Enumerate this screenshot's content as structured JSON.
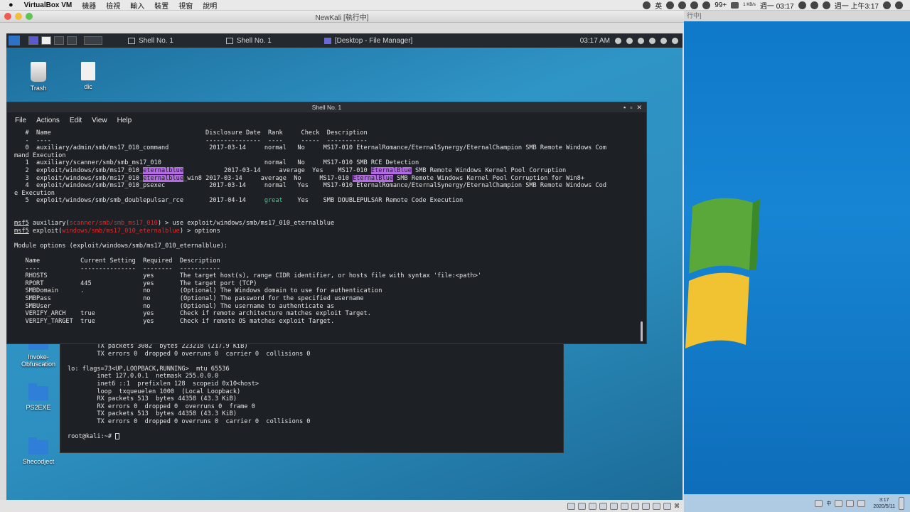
{
  "macbar": {
    "app": "VirtualBox VM",
    "menus": [
      "機器",
      "檢視",
      "輸入",
      "裝置",
      "視窗",
      "說明"
    ],
    "lang": "英",
    "battery_pct": "99+",
    "net_speed_up": "1 KB/s",
    "net_speed_down": "1 KB/s",
    "clock_small": "週一 03:17",
    "clock": "週一 上午3:17"
  },
  "vbox": {
    "title": "NewKali [執行中]",
    "right_title": "行中]"
  },
  "kali_panel": {
    "tasks": [
      {
        "label": "Shell No. 1"
      },
      {
        "label": "Shell No. 1"
      },
      {
        "label": "[Desktop - File Manager]"
      }
    ],
    "time": "03:17 AM"
  },
  "desktop_icons": [
    {
      "label": "Trash"
    },
    {
      "label": "dic"
    },
    {
      "label": "Invoke-Obfuscation"
    },
    {
      "label": "PS2EXE"
    },
    {
      "label": "Shecodject"
    }
  ],
  "fg_terminal": {
    "title": "Shell No. 1",
    "menu": [
      "File",
      "Actions",
      "Edit",
      "View",
      "Help"
    ],
    "search_header": "   #  Name                                          Disclosure Date  Rank     Check  Description",
    "search_rule": "   -  ----                                          ---------------  ----     -----  -----------",
    "search_rows": [
      {
        "pre": "   0  auxiliary/admin/smb/ms17_010_command           ",
        "hl": "",
        "mid": "",
        "date": "2017-03-14     ",
        "rank": "normal ",
        "check": "No     ",
        "desc": "MS17-010 EternalRomance/EternalSynergy/EternalChampion SMB Remote Windows Com"
      },
      {
        "pre": "mand Execution",
        "hl": "",
        "mid": "",
        "date": "",
        "rank": "",
        "check": "",
        "desc": ""
      },
      {
        "pre": "   1  auxiliary/scanner/smb/smb_ms17_010             ",
        "hl": "",
        "mid": "",
        "date": "               ",
        "rank": "normal ",
        "check": "No     ",
        "desc": "MS17-010 SMB RCE Detection"
      },
      {
        "pre": "   2  exploit/windows/smb/ms17_010_",
        "hl": "eternalblue",
        "mid": "     ",
        "date": "2017-03-14     ",
        "rank": "average",
        "check": "Yes    ",
        "desc": "MS17-010 "
      },
      {
        "pre": "   3  exploit/windows/smb/ms17_010_",
        "hl": "eternalblue",
        "mid": "_win8",
        "date": "2017-03-14     ",
        "rank": "average",
        "check": "No     ",
        "desc": "MS17-010 "
      },
      {
        "pre": "   4  exploit/windows/smb/ms17_010_psexec            ",
        "hl": "",
        "mid": "",
        "date": "2017-03-14     ",
        "rank": "normal ",
        "check": "Yes    ",
        "desc": "MS17-010 EternalRomance/EternalSynergy/EternalChampion SMB Remote Windows Cod"
      },
      {
        "pre": "e Execution",
        "hl": "",
        "mid": "",
        "date": "",
        "rank": "",
        "check": "",
        "desc": ""
      },
      {
        "pre": "   5  exploit/windows/smb/smb_doublepulsar_rce       ",
        "hl": "",
        "mid": "",
        "date": "2017-04-14     ",
        "rank": "great  ",
        "check": "Yes    ",
        "desc": "SMB DOUBLEPULSAR Remote Code Execution"
      }
    ],
    "desc_hl": "EternalBlue",
    "desc2_rest": " SMB Remote Windows Kernel Pool Corruption",
    "desc3_rest": " SMB Remote Windows Kernel Pool Corruption for Win8+",
    "prompt1_a": "msf5",
    "prompt1_b": " auxiliary(",
    "prompt1_mod": "scanner/smb/smb_ms17_010",
    "prompt1_c": ") > use exploit/windows/smb/ms17_010_eternalblue",
    "prompt2_a": "msf5",
    "prompt2_b": " exploit(",
    "prompt2_mod": "windows/smb/ms17_010_eternalblue",
    "prompt2_c": ") > options",
    "module_options": "Module options (exploit/windows/smb/ms17_010_eternalblue):",
    "opt_header": "   Name           Current Setting  Required  Description",
    "opt_rule": "   ----           ---------------  --------  -----------",
    "opt_rows": [
      "   RHOSTS                          yes       The target host(s), range CIDR identifier, or hosts file with syntax 'file:<path>'",
      "   RPORT          445              yes       The target port (TCP)",
      "   SMBDomain      .                no        (Optional) The Windows domain to use for authentication",
      "   SMBPass                         no        (Optional) The password for the specified username",
      "   SMBUser                         no        (Optional) The username to authenticate as",
      "   VERIFY_ARCH    true             yes       Check if remote architecture matches exploit Target.",
      "   VERIFY_TARGET  true             yes       Check if remote OS matches exploit Target."
    ]
  },
  "bg_terminal": {
    "lines": [
      "        TX packets 3082  bytes 223218 (217.9 KiB)",
      "        TX errors 0  dropped 0 overruns 0  carrier 0  collisions 0",
      "",
      "lo: flags=73<UP,LOOPBACK,RUNNING>  mtu 65536",
      "        inet 127.0.0.1  netmask 255.0.0.0",
      "        inet6 ::1  prefixlen 128  scopeid 0x10<host>",
      "        loop  txqueuelen 1000  (Local Loopback)",
      "        RX packets 513  bytes 44358 (43.3 KiB)",
      "        RX errors 0  dropped 0  overruns 0  frame 0",
      "        TX packets 513  bytes 44358 (43.3 KiB)",
      "        TX errors 0  dropped 0 overruns 0  carrier 0  collisions 0",
      "",
      "root@kali:~# "
    ]
  },
  "win7": {
    "time": "3:17",
    "date": "2020/5/11",
    "lang": "中"
  }
}
